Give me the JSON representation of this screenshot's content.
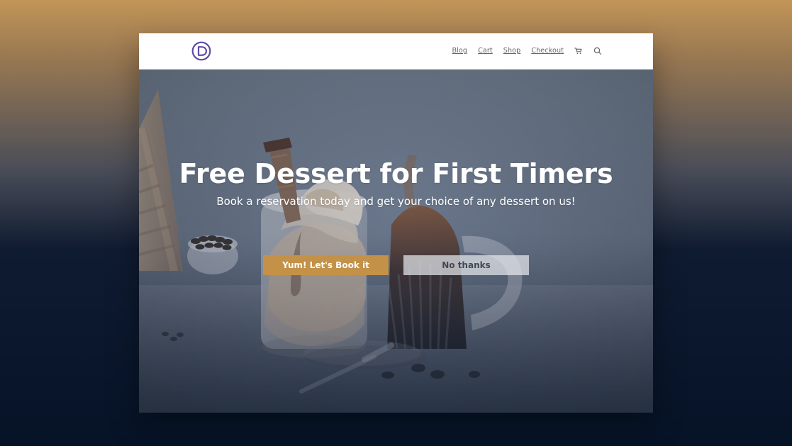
{
  "header": {
    "nav": {
      "items": [
        {
          "label": "Blog"
        },
        {
          "label": "Cart"
        },
        {
          "label": "Shop"
        },
        {
          "label": "Checkout"
        }
      ]
    },
    "icons": {
      "logo": "d-logo-icon",
      "cart": "shopping-cart-icon",
      "search": "search-icon"
    }
  },
  "hero": {
    "title": "Free Dessert for First Timers",
    "subtitle": "Book a reservation today and get your choice of any dessert on us!",
    "buttons": {
      "primary": "Yum! Let's Book it",
      "secondary": "No thanks"
    }
  },
  "colors": {
    "logo": "#5e4ba8",
    "primary_button": "#c39248",
    "secondary_button": "#dfe2e8",
    "nav_text": "#666666"
  }
}
